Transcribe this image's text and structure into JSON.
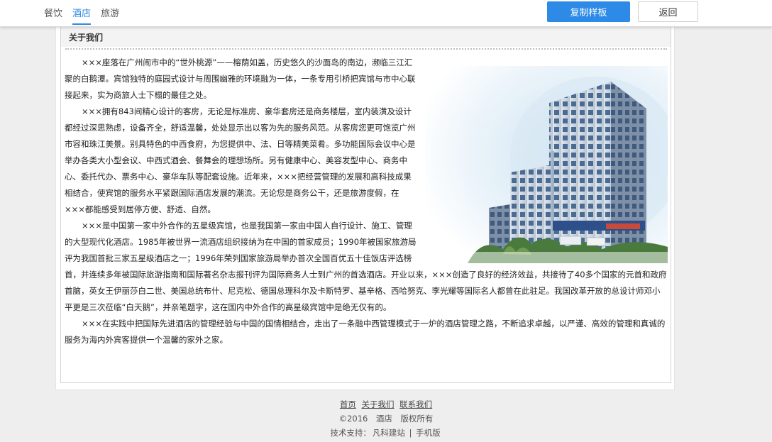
{
  "topbar": {
    "tabs": [
      {
        "label": "餐饮"
      },
      {
        "label": "酒店"
      },
      {
        "label": "旅游"
      }
    ],
    "copy_button": "复制样板",
    "back_button": "返回"
  },
  "panel": {
    "title": "关于我们",
    "paragraphs": [
      "×××座落在广州闹市中的“世外桃源”——榕荫如盖，历史悠久的沙面岛的南边，濒临三江汇聚的白鹅潭。宾馆独特的庭园式设计与周围幽雅的环境融为一体，一条专用引桥把宾馆与市中心联接起来，实为商旅人士下榻的最佳之处。",
      "×××拥有843间精心设计的客房，无论是标准房、豪华套房还是商务楼层，室内装潢及设计都经过深思熟虑，设备齐全，舒适温馨，处处显示出以客为先的服务风范。从客房您更可饱览广州市容和珠江美景。别具特色的中西食府，为您提供中、法、日等精美菜肴。多功能国际会议中心是举办各类大小型会议、中西式酒会、餐舞会的理想场所。另有健康中心、美容发型中心、商务中心、委托代办、票务中心、豪华车队等配套设施。近年来，×××把经营管理的发展和高科技成果相结合，使宾馆的服务水平紧跟国际酒店发展的潮流。无论您是商务公干，还是旅游度假，在×××都能感受到居停方便、舒适、自然。",
      "×××是中国第一家中外合作的五星级宾馆，也是我国第一家由中国人自行设计、施工、管理的大型现代化酒店。1985年被世界一流酒店组织接纳为在中国的首家成员；1990年被国家旅游局评为我国首批三家五星级酒店之一；1996年荣列国家旅游局举办首次全国百优五十佳饭店评选榜首，并连续多年被国际旅游指南和国际著名杂志报刊评为国际商务人士到广州的首选酒店。开业以来，×××创造了良好的经济效益，共接待了40多个国家的元首和政府首脑，英女王伊丽莎白二世、美国总统布什、尼克松、德国总理科尔及卡斯特罗、基辛格、西哈努克、李光耀等国际名人都曾在此驻足。我国改革开放的总设计师邓小平更是三次莅临“白天鹅”，并亲笔题字，这在国内中外合作的高星级宾馆中是绝无仅有的。",
      "×××在实践中把国际先进酒店的管理经验与中国的国情相结合，走出了一条融中西管理模式于一炉的酒店管理之路，不断追求卓越，以严谨、高效的管理和真诚的服务为海内外宾客提供一个温馨的家外之家。"
    ]
  },
  "footer": {
    "links": [
      "首页",
      "关于我们",
      "联系我们"
    ],
    "copyright": "©2016　酒店　版权所有",
    "support_prefix": "技术支持：",
    "support_name": "凡科建站",
    "separator": "|",
    "mobile": "手机版"
  },
  "colors": {
    "accent": "#2d8ae6",
    "background": "#eeeeee"
  }
}
